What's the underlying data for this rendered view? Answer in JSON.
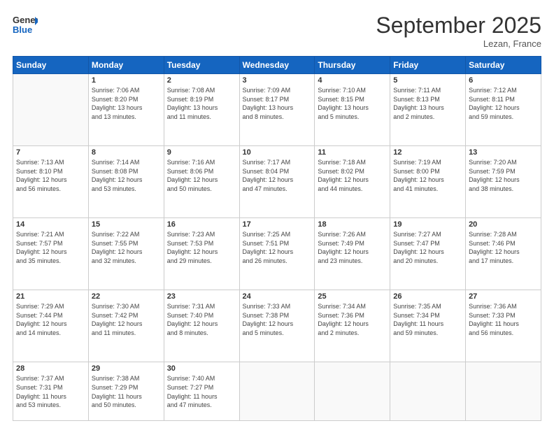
{
  "logo": {
    "line1": "General",
    "line2": "Blue"
  },
  "title": "September 2025",
  "subtitle": "Lezan, France",
  "weekdays": [
    "Sunday",
    "Monday",
    "Tuesday",
    "Wednesday",
    "Thursday",
    "Friday",
    "Saturday"
  ],
  "weeks": [
    [
      {
        "day": "",
        "info": ""
      },
      {
        "day": "1",
        "info": "Sunrise: 7:06 AM\nSunset: 8:20 PM\nDaylight: 13 hours\nand 13 minutes."
      },
      {
        "day": "2",
        "info": "Sunrise: 7:08 AM\nSunset: 8:19 PM\nDaylight: 13 hours\nand 11 minutes."
      },
      {
        "day": "3",
        "info": "Sunrise: 7:09 AM\nSunset: 8:17 PM\nDaylight: 13 hours\nand 8 minutes."
      },
      {
        "day": "4",
        "info": "Sunrise: 7:10 AM\nSunset: 8:15 PM\nDaylight: 13 hours\nand 5 minutes."
      },
      {
        "day": "5",
        "info": "Sunrise: 7:11 AM\nSunset: 8:13 PM\nDaylight: 13 hours\nand 2 minutes."
      },
      {
        "day": "6",
        "info": "Sunrise: 7:12 AM\nSunset: 8:11 PM\nDaylight: 12 hours\nand 59 minutes."
      }
    ],
    [
      {
        "day": "7",
        "info": "Sunrise: 7:13 AM\nSunset: 8:10 PM\nDaylight: 12 hours\nand 56 minutes."
      },
      {
        "day": "8",
        "info": "Sunrise: 7:14 AM\nSunset: 8:08 PM\nDaylight: 12 hours\nand 53 minutes."
      },
      {
        "day": "9",
        "info": "Sunrise: 7:16 AM\nSunset: 8:06 PM\nDaylight: 12 hours\nand 50 minutes."
      },
      {
        "day": "10",
        "info": "Sunrise: 7:17 AM\nSunset: 8:04 PM\nDaylight: 12 hours\nand 47 minutes."
      },
      {
        "day": "11",
        "info": "Sunrise: 7:18 AM\nSunset: 8:02 PM\nDaylight: 12 hours\nand 44 minutes."
      },
      {
        "day": "12",
        "info": "Sunrise: 7:19 AM\nSunset: 8:00 PM\nDaylight: 12 hours\nand 41 minutes."
      },
      {
        "day": "13",
        "info": "Sunrise: 7:20 AM\nSunset: 7:59 PM\nDaylight: 12 hours\nand 38 minutes."
      }
    ],
    [
      {
        "day": "14",
        "info": "Sunrise: 7:21 AM\nSunset: 7:57 PM\nDaylight: 12 hours\nand 35 minutes."
      },
      {
        "day": "15",
        "info": "Sunrise: 7:22 AM\nSunset: 7:55 PM\nDaylight: 12 hours\nand 32 minutes."
      },
      {
        "day": "16",
        "info": "Sunrise: 7:23 AM\nSunset: 7:53 PM\nDaylight: 12 hours\nand 29 minutes."
      },
      {
        "day": "17",
        "info": "Sunrise: 7:25 AM\nSunset: 7:51 PM\nDaylight: 12 hours\nand 26 minutes."
      },
      {
        "day": "18",
        "info": "Sunrise: 7:26 AM\nSunset: 7:49 PM\nDaylight: 12 hours\nand 23 minutes."
      },
      {
        "day": "19",
        "info": "Sunrise: 7:27 AM\nSunset: 7:47 PM\nDaylight: 12 hours\nand 20 minutes."
      },
      {
        "day": "20",
        "info": "Sunrise: 7:28 AM\nSunset: 7:46 PM\nDaylight: 12 hours\nand 17 minutes."
      }
    ],
    [
      {
        "day": "21",
        "info": "Sunrise: 7:29 AM\nSunset: 7:44 PM\nDaylight: 12 hours\nand 14 minutes."
      },
      {
        "day": "22",
        "info": "Sunrise: 7:30 AM\nSunset: 7:42 PM\nDaylight: 12 hours\nand 11 minutes."
      },
      {
        "day": "23",
        "info": "Sunrise: 7:31 AM\nSunset: 7:40 PM\nDaylight: 12 hours\nand 8 minutes."
      },
      {
        "day": "24",
        "info": "Sunrise: 7:33 AM\nSunset: 7:38 PM\nDaylight: 12 hours\nand 5 minutes."
      },
      {
        "day": "25",
        "info": "Sunrise: 7:34 AM\nSunset: 7:36 PM\nDaylight: 12 hours\nand 2 minutes."
      },
      {
        "day": "26",
        "info": "Sunrise: 7:35 AM\nSunset: 7:34 PM\nDaylight: 11 hours\nand 59 minutes."
      },
      {
        "day": "27",
        "info": "Sunrise: 7:36 AM\nSunset: 7:33 PM\nDaylight: 11 hours\nand 56 minutes."
      }
    ],
    [
      {
        "day": "28",
        "info": "Sunrise: 7:37 AM\nSunset: 7:31 PM\nDaylight: 11 hours\nand 53 minutes."
      },
      {
        "day": "29",
        "info": "Sunrise: 7:38 AM\nSunset: 7:29 PM\nDaylight: 11 hours\nand 50 minutes."
      },
      {
        "day": "30",
        "info": "Sunrise: 7:40 AM\nSunset: 7:27 PM\nDaylight: 11 hours\nand 47 minutes."
      },
      {
        "day": "",
        "info": ""
      },
      {
        "day": "",
        "info": ""
      },
      {
        "day": "",
        "info": ""
      },
      {
        "day": "",
        "info": ""
      }
    ]
  ]
}
